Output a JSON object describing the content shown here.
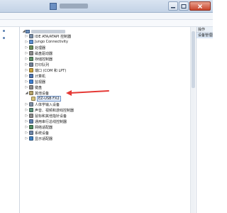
{
  "window": {
    "app_icon": "computer-management-icon",
    "minimize_icon": "minimize-icon",
    "maximize_icon": "maximize-icon",
    "close_icon": "close-icon"
  },
  "tree": {
    "root_icon": "computer-icon",
    "categories": [
      {
        "label": "IDE ATA/ATAPI 控制器",
        "icon": "ide-controller-icon",
        "color": "#7a8fa8",
        "expander": "▷"
      },
      {
        "label": "Jungo Connectivity",
        "icon": "usb-connectivity-icon",
        "color": "#5b8fcf",
        "expander": "▷"
      },
      {
        "label": "处理器",
        "icon": "processor-icon",
        "color": "#6b8e5a",
        "expander": "▷"
      },
      {
        "label": "磁盘驱动器",
        "icon": "disk-drive-icon",
        "color": "#8c8c8c",
        "expander": "▷"
      },
      {
        "label": "存储控制器",
        "icon": "storage-controller-icon",
        "color": "#5f8f6a",
        "expander": "▷"
      },
      {
        "label": "打印队列",
        "icon": "printer-icon",
        "color": "#6f7f95",
        "expander": "▷"
      },
      {
        "label": "端口 (COM 和 LPT)",
        "icon": "port-icon",
        "color": "#c9a23a",
        "expander": "▷"
      },
      {
        "label": "计算机",
        "icon": "computer-icon",
        "color": "#4f76b0",
        "expander": "▷"
      },
      {
        "label": "监视器",
        "icon": "monitor-icon",
        "color": "#3f7fcf",
        "expander": "▷"
      },
      {
        "label": "键盘",
        "icon": "keyboard-icon",
        "color": "#8a8a8a",
        "expander": "▷"
      },
      {
        "label": "其他设备",
        "icon": "other-devices-icon",
        "color": "#b5a26a",
        "expander": "◢"
      }
    ],
    "other_device_child": {
      "label": "EZ-USB FX2",
      "icon": "unknown-device-icon",
      "color": "#d6c27a"
    },
    "categories_after": [
      {
        "label": "人体学输入设备",
        "icon": "hid-icon",
        "color": "#7f8fa3",
        "expander": "▷"
      },
      {
        "label": "声音、视频和游戏控制器",
        "icon": "sound-icon",
        "color": "#5a8f7a",
        "expander": "▷"
      },
      {
        "label": "鼠标和其他指针设备",
        "icon": "mouse-icon",
        "color": "#8a8a8a",
        "expander": "▷"
      },
      {
        "label": "通用串行总线控制器",
        "icon": "usb-controller-icon",
        "color": "#5d7fae",
        "expander": "▷"
      },
      {
        "label": "网络适配器",
        "icon": "network-adapter-icon",
        "color": "#4f8a5f",
        "expander": "▷"
      },
      {
        "label": "系统设备",
        "icon": "system-device-icon",
        "color": "#6e86a8",
        "expander": "▷"
      },
      {
        "label": "显示适配器",
        "icon": "display-adapter-icon",
        "color": "#3f7fbf",
        "expander": "▷"
      }
    ]
  },
  "actions": {
    "header": "操作",
    "selected": "设备管理器"
  },
  "annotation": {
    "color": "#e53935"
  }
}
